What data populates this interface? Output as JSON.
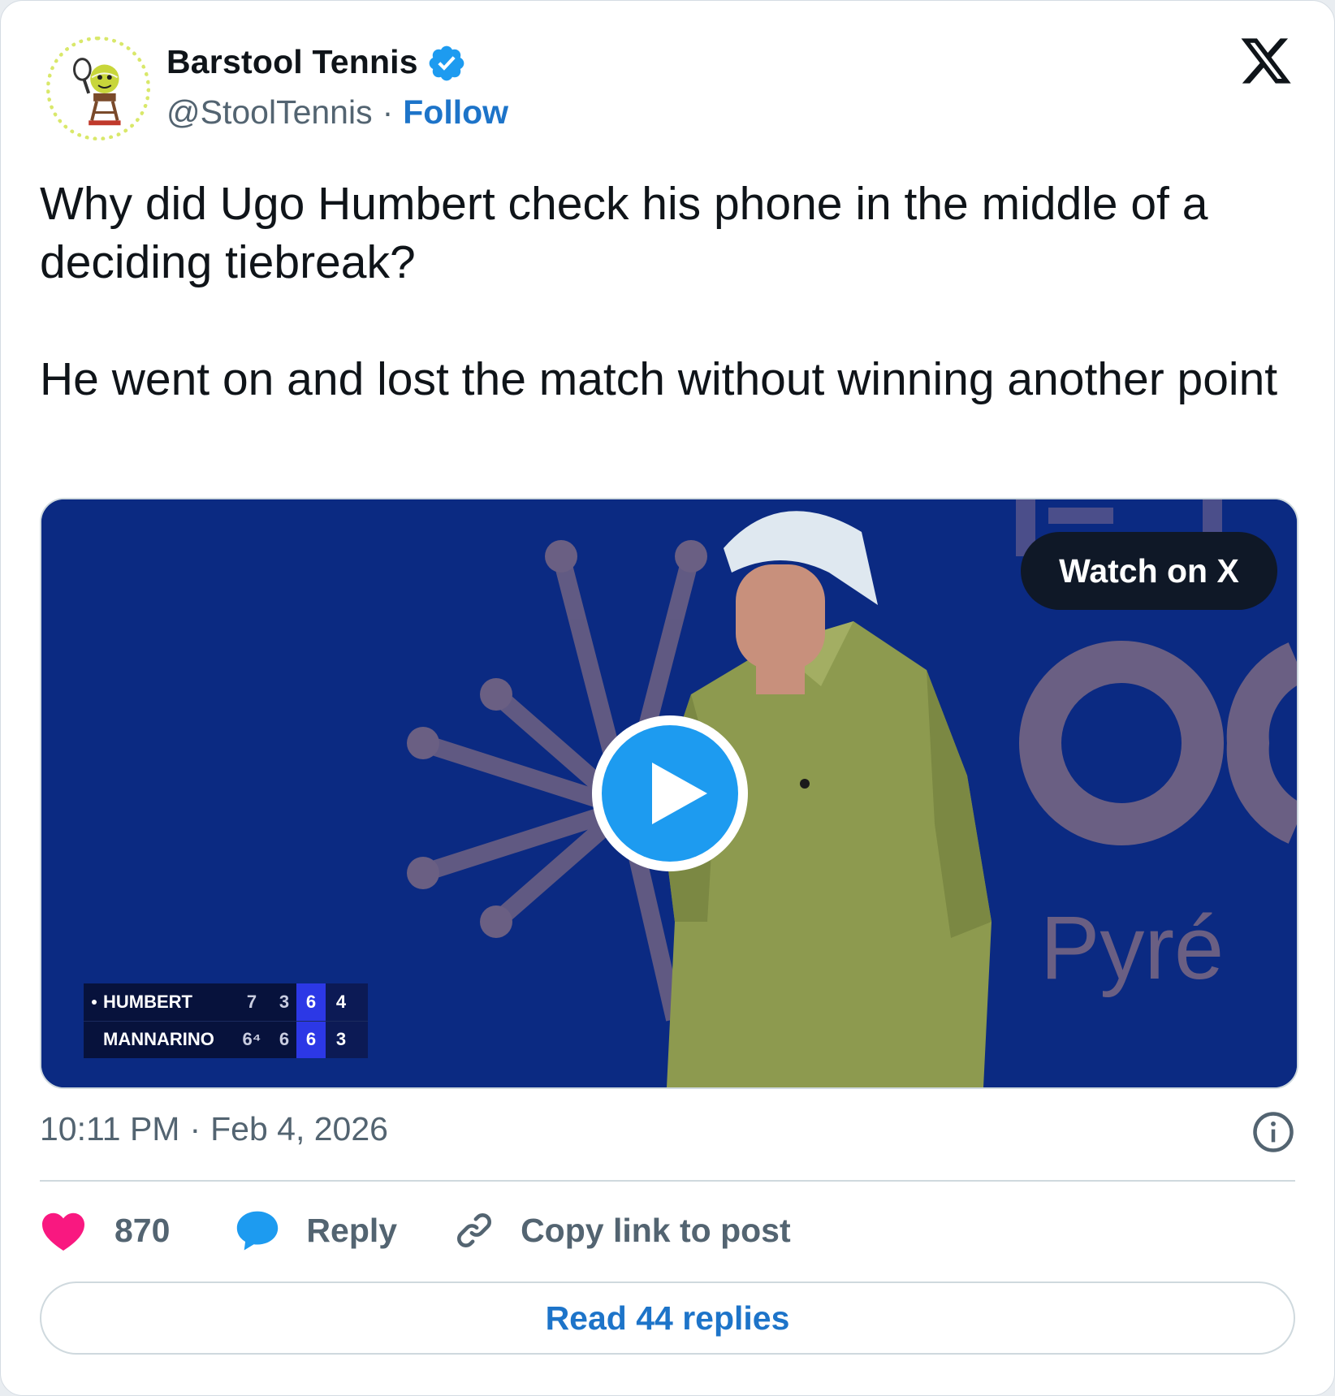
{
  "author": {
    "display_name": "Barstool Tennis",
    "handle": "@StoolTennis",
    "separator": "·",
    "follow_label": "Follow",
    "verified": true
  },
  "tweet": {
    "paragraphs": [
      "Why did Ugo Humbert check his phone in the middle of a deciding tiebreak?",
      "He went on and lost the match without winning another point"
    ]
  },
  "media": {
    "watch_label": "Watch on X",
    "background_text": "Pyré",
    "scoreboard": {
      "rows": [
        {
          "name": "HUMBERT",
          "serving": true,
          "s1": "7",
          "s2": "3",
          "s3": "6",
          "s4": "4"
        },
        {
          "name": "MANNARINO",
          "serving": false,
          "s1": "6⁴",
          "s2": "6",
          "s3": "6",
          "s4": "3"
        }
      ]
    }
  },
  "meta": {
    "time": "10:11 PM",
    "separator": "·",
    "date": "Feb 4, 2026"
  },
  "actions": {
    "likes": "870",
    "reply_label": "Reply",
    "copy_label": "Copy link to post"
  },
  "read_replies_label": "Read 44 replies",
  "colors": {
    "accent": "#1d9bf0",
    "link": "#1d74c9",
    "like": "#f91880",
    "muted": "#536471",
    "text": "#0f1419"
  },
  "icons": {
    "verified": "verified-badge-icon",
    "platform": "x-logo-icon",
    "info": "info-icon",
    "like": "heart-icon",
    "reply": "speech-bubble-icon",
    "copy": "link-icon",
    "play": "play-icon"
  }
}
